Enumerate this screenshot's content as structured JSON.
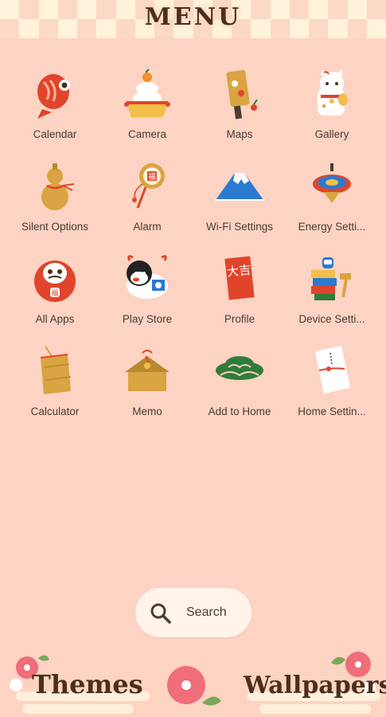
{
  "header": {
    "title": "MENU"
  },
  "apps": [
    {
      "label": "Calendar",
      "icon": "sea-bream-icon"
    },
    {
      "label": "Camera",
      "icon": "kagami-mochi-icon"
    },
    {
      "label": "Maps",
      "icon": "hagoita-paddle-icon"
    },
    {
      "label": "Gallery",
      "icon": "lucky-cat-icon"
    },
    {
      "label": "Silent Options",
      "icon": "gourd-icon"
    },
    {
      "label": "Alarm",
      "icon": "drum-rattle-icon"
    },
    {
      "label": "Wi-Fi Settings",
      "icon": "mount-fuji-icon"
    },
    {
      "label": "Energy Setti...",
      "icon": "spinning-top-icon"
    },
    {
      "label": "All Apps",
      "icon": "daruma-icon"
    },
    {
      "label": "Play Store",
      "icon": "ox-icon"
    },
    {
      "label": "Profile",
      "icon": "kanji-plaque-icon"
    },
    {
      "label": "Device Setti...",
      "icon": "daruma-otoshi-icon"
    },
    {
      "label": "Calculator",
      "icon": "straw-bag-icon"
    },
    {
      "label": "Memo",
      "icon": "ema-plaque-icon"
    },
    {
      "label": "Add to Home",
      "icon": "pine-icon"
    },
    {
      "label": "Home Settin...",
      "icon": "envelope-icon"
    }
  ],
  "search": {
    "label": "Search"
  },
  "bottom": {
    "themes": "Themes",
    "wallpapers": "Wallpapers"
  },
  "fuku_kanji": "福",
  "profile_kanji": "大吉",
  "colors": {
    "background": "#fdd3c3",
    "title": "#4a2f1a",
    "red": "#e0452b",
    "gold": "#d9a441"
  }
}
